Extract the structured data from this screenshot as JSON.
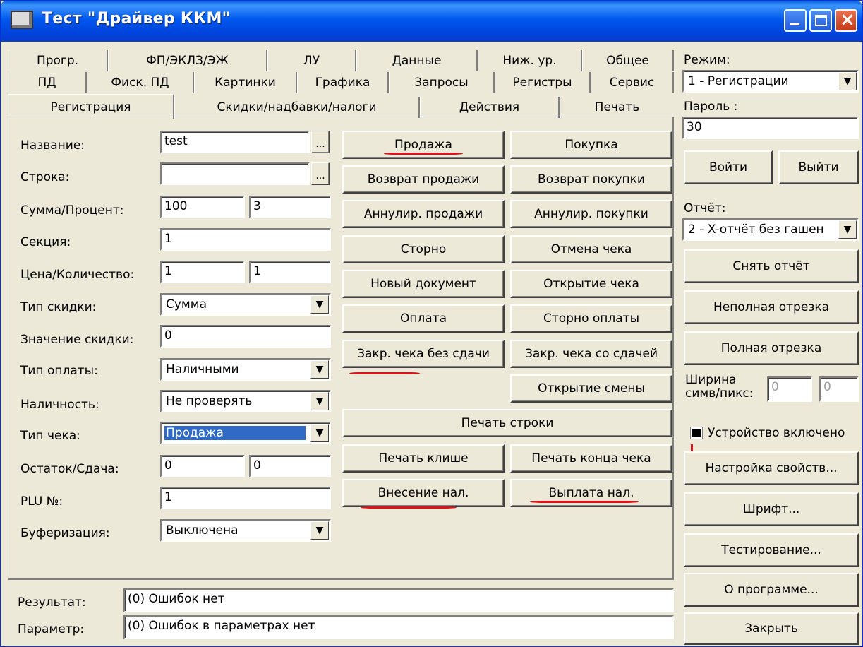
{
  "window": {
    "title": "Тест \"Драйвер ККМ\""
  },
  "tabs": {
    "row1": [
      "Прогр.",
      "ФП/ЭКЛЗ/ЭЖ",
      "ЛУ",
      "Данные",
      "Ниж. ур.",
      "Общее"
    ],
    "row2": [
      "ПД",
      "Фиск. ПД",
      "Картинки",
      "Графика",
      "Запросы",
      "Регистры",
      "Сервис"
    ],
    "row3": [
      "Регистрация",
      "Скидки/надбавки/налоги",
      "Действия",
      "Печать"
    ],
    "active": "Регистрация"
  },
  "form": {
    "name_label": "Название:",
    "name_value": "test",
    "line_label": "Строка:",
    "line_value": "",
    "sum_label": "Сумма/Процент:",
    "sum_value": "100",
    "percent_value": "3",
    "section_label": "Секция:",
    "section_value": "1",
    "price_label": "Цена/Количество:",
    "price_value": "1",
    "qty_value": "1",
    "disc_type_label": "Тип скидки:",
    "disc_type_value": "Сумма",
    "disc_value_label": "Значение скидки:",
    "disc_value": "0",
    "pay_type_label": "Тип оплаты:",
    "pay_type_value": "Наличными",
    "cash_label": "Наличность:",
    "cash_value": "Не проверять",
    "check_type_label": "Тип чека:",
    "check_type_value": "Продажа",
    "rest_label": "Остаток/Сдача:",
    "rest_value": "0",
    "change_value": "0",
    "plu_label": "PLU №:",
    "plu_value": "1",
    "buffer_label": "Буферизация:",
    "buffer_value": "Выключена",
    "dots": "..."
  },
  "actions": {
    "sale": "Продажа",
    "purchase": "Покупка",
    "return_sale": "Возврат продажи",
    "return_purchase": "Возврат покупки",
    "annul_sale": "Аннулир. продажи",
    "annul_purchase": "Аннулир. покупки",
    "storno": "Сторно",
    "cancel_check": "Отмена чека",
    "new_doc": "Новый документ",
    "open_check": "Открытие чека",
    "payment": "Оплата",
    "storno_payment": "Сторно оплаты",
    "close_no_change": "Закр. чека без сдачи",
    "close_with_change": "Закр. чека со сдачей",
    "open_shift": "Открытие смены",
    "print_line": "Печать строки",
    "print_cliche": "Печать клише",
    "print_end": "Печать конца чека",
    "cash_in": "Внесение нал.",
    "cash_out": "Выплата нал."
  },
  "status": {
    "result_label": "Результат:",
    "result_value": "(0) Ошибок нет",
    "param_label": "Параметр:",
    "param_value": "(0) Ошибок в параметрах нет"
  },
  "side": {
    "mode_label": "Режим:",
    "mode_value": "1 - Регистрации",
    "password_label": "Пароль :",
    "password_value": "30",
    "login": "Войти",
    "logout": "Выйти",
    "report_label": "Отчёт:",
    "report_value": "2 - X-отчёт без гашен",
    "take_report": "Снять отчёт",
    "partial_cut": "Неполная отрезка",
    "full_cut": "Полная отрезка",
    "width_label_1": "Ширина",
    "width_label_2": "симв/пикс:",
    "width_chars": "0",
    "width_pixels": "0",
    "device_on": "Устройство включено",
    "setup": "Настройка свойств...",
    "font": "Шрифт...",
    "testing": "Тестирование...",
    "about": "О программе...",
    "close": "Закрыть"
  },
  "colors": {
    "titlebar": "#0058ee",
    "selection": "#316ac5",
    "annotation": "#e0101a"
  }
}
